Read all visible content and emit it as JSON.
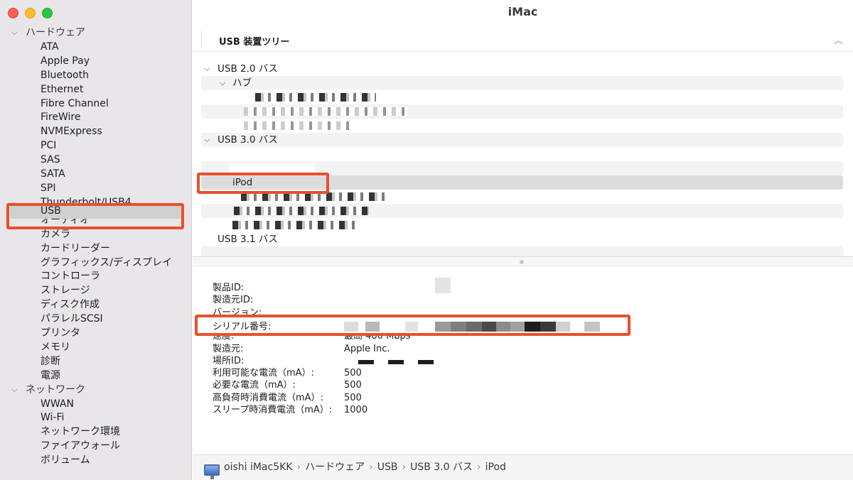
{
  "window": {
    "title": "iMac"
  },
  "sidebar": {
    "group_hardware": "ハードウェア",
    "hardware_items": [
      "ATA",
      "Apple Pay",
      "Bluetooth",
      "Ethernet",
      "Fibre Channel",
      "FireWire",
      "NVMExpress",
      "PCI",
      "SAS",
      "SATA",
      "SPI",
      "Thunderbolt/USB4",
      "USB",
      "オーディオ",
      "カメラ",
      "カードリーダー",
      "グラフィックス/ディスプレイ",
      "コントローラ",
      "ストレージ",
      "ディスク作成",
      "パラレルSCSI",
      "プリンタ",
      "メモリ",
      "診断",
      "電源"
    ],
    "selected": "USB",
    "group_network": "ネットワーク",
    "network_items": [
      "WWAN",
      "Wi-Fi",
      "ネットワーク環境",
      "ファイアウォール",
      "ボリューム"
    ]
  },
  "tree": {
    "header": "USB 装置ツリー",
    "usb20_bus": "USB 2.0 バス",
    "hub": "ハブ",
    "usb30_bus": "USB 3.0 バス",
    "ipod": "iPod",
    "usb31_bus": "USB 3.1 バス"
  },
  "details": {
    "rows": [
      {
        "key": "製品ID:",
        "value": ""
      },
      {
        "key": "製造元ID:",
        "value": ""
      },
      {
        "key": "バージョン:",
        "value": ""
      },
      {
        "key": "シリアル番号:",
        "value": ""
      },
      {
        "key": "速度:",
        "value": "最高 480 Mbps"
      },
      {
        "key": "製造元:",
        "value": "Apple Inc."
      },
      {
        "key": "場所ID:",
        "value": ""
      },
      {
        "key": "利用可能な電流（mA）:",
        "value": "500"
      },
      {
        "key": "必要な電流（mA）:",
        "value": "500"
      },
      {
        "key": "高負荷時消費電流（mA）:",
        "value": "500"
      },
      {
        "key": "スリープ時消費電流（mA）:",
        "value": "1000"
      }
    ]
  },
  "statusbar": {
    "computer": "oishi iMac5KK",
    "crumb1": "ハードウェア",
    "crumb2": "USB",
    "crumb3": "USB 3.0 バス",
    "crumb4": "iPod",
    "separator": "›"
  },
  "colors": {
    "annotation": "#e8502c",
    "sidebar_bg": "#e8e6e8",
    "selection": "#d0d0d0"
  }
}
